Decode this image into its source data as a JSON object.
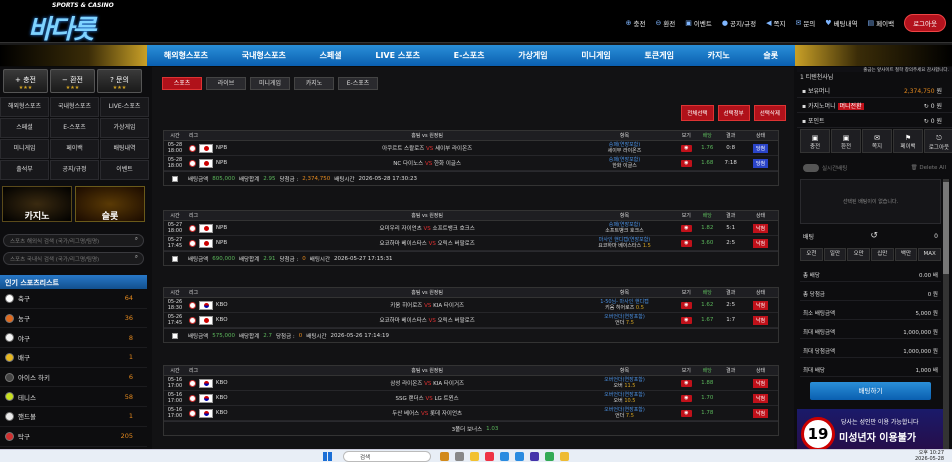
{
  "header": {
    "logo_sub": "SPORTS & CASINO",
    "logo_main": "바다릇",
    "nav": [
      {
        "icon": "plus-circle",
        "label": "충전"
      },
      {
        "icon": "minus-circle",
        "label": "환전"
      },
      {
        "icon": "gift",
        "label": "이벤트"
      },
      {
        "icon": "user",
        "label": "공지/규정"
      },
      {
        "icon": "megaphone",
        "label": "쪽지"
      },
      {
        "icon": "envelope",
        "label": "문의"
      },
      {
        "icon": "chat",
        "label": "베팅내역"
      },
      {
        "icon": "card",
        "label": "페이백"
      }
    ],
    "logout": "로그아웃"
  },
  "main_nav": [
    "해외형스포츠",
    "국내형스포츠",
    "스페셜",
    "LIVE 스포츠",
    "E-스포츠",
    "가상게임",
    "미니게임",
    "토큰게임",
    "카지노",
    "슬롯"
  ],
  "left": {
    "quick": [
      {
        "label": "충전",
        "icon": "+"
      },
      {
        "label": "환전",
        "icon": "−"
      },
      {
        "label": "문의",
        "icon": "?"
      }
    ],
    "grid": [
      "해외형스포츠",
      "국내형스포츠",
      "LIVE-스포츠",
      "스페셜",
      "E-스포츠",
      "가상게임",
      "미니게임",
      "페이백",
      "배팅내역",
      "출석부",
      "공지/규정",
      "이벤트"
    ],
    "casino": "카지노",
    "slot": "슬롯",
    "search1_ph": "스포츠 해외식 검색 (국가/리그명/팀명)",
    "search2_ph": "스포츠 국내식 검색 (국가/리그명/팀명)",
    "popular": "인기 스포츠리스트",
    "sports": [
      {
        "name": "축구",
        "count": "64",
        "color": "#ffffff"
      },
      {
        "name": "농구",
        "count": "36",
        "color": "#e06a1e"
      },
      {
        "name": "야구",
        "count": "8",
        "color": "#f4f4f4"
      },
      {
        "name": "배구",
        "count": "1",
        "color": "#e8b820"
      },
      {
        "name": "아이스 하키",
        "count": "6",
        "color": "#444"
      },
      {
        "name": "테니스",
        "count": "58",
        "color": "#c8e020"
      },
      {
        "name": "핸드볼",
        "count": "1",
        "color": "#eaeaea"
      },
      {
        "name": "탁구",
        "count": "205",
        "color": "#d03030"
      }
    ]
  },
  "center": {
    "tabs": [
      "스포츠",
      "라이브",
      "미니게임",
      "카지노",
      "E-스포츠"
    ],
    "actions": [
      "전체선택",
      "선택청부",
      "선택삭제"
    ],
    "headers": [
      "시간",
      "리그",
      "홈팀 vs 원정팀",
      "항목",
      "보기",
      "배당",
      "결과",
      "상태"
    ],
    "vs": "VS",
    "tables": [
      {
        "rows": [
          {
            "date": "05-28",
            "time": "18:00",
            "flag": "jp",
            "league": "NPB",
            "home": "아쿠르트 스왈로즈",
            "away": "세이부 라이온즈",
            "pick": "승패(연장포함)",
            "pick2": "세이부 라이온즈",
            "pick_odds": "",
            "odds": "1.76",
            "result": "0:8",
            "status": "당첨",
            "st": "win"
          },
          {
            "date": "05-28",
            "time": "18:00",
            "flag": "jp",
            "league": "NPB",
            "home": "NC 다이노스",
            "away": "한화 이글스",
            "pick": "승패(연장포함)",
            "pick2": "한화 이글스",
            "pick_odds": "",
            "odds": "1.68",
            "result": "7:18",
            "status": "당첨",
            "st": "win"
          }
        ],
        "sum": {
          "amount_label": "배팅금액",
          "amount": "805,000",
          "odds_label": "배당합계",
          "odds": "2.95",
          "win_label": "당첨금 :",
          "win": "2,374,750",
          "time_label": "배팅시간",
          "time": "2026-05-28 17:30:23"
        }
      },
      {
        "rows": [
          {
            "date": "05-27",
            "time": "18:00",
            "flag": "jp",
            "league": "NPB",
            "home": "요미우리 자이언츠",
            "away": "소프트뱅크 호크스",
            "pick": "승패(연장포함)",
            "pick2": "소프트뱅크 호크스",
            "pick_odds": "",
            "odds": "1.82",
            "result": "5:1",
            "status": "낙첨",
            "st": "lose"
          },
          {
            "date": "05-27",
            "time": "17:45",
            "flag": "jp",
            "league": "NPB",
            "home": "요코하마 베이스타스",
            "away": "오릭스 버팔로즈",
            "pick": "마사인 핸디캡(연장포함)",
            "pick2": "요코하마 베이스타스",
            "pick_odds": "1.5",
            "odds": "3.60",
            "result": "2:5",
            "status": "낙첨",
            "st": "lose"
          }
        ],
        "sum": {
          "amount_label": "배팅금액",
          "amount": "690,000",
          "odds_label": "배당합계",
          "odds": "2.91",
          "win_label": "당첨금 :",
          "win": "0",
          "time_label": "배팅시간",
          "time": "2026-05-27 17:15:31"
        }
      },
      {
        "rows": [
          {
            "date": "05-26",
            "time": "18:30",
            "flag": "kr",
            "league": "KBO",
            "home": "키움 히어로즈",
            "away": "KIA 타이거즈",
            "pick": "1-50님- 마사인 핸디캡",
            "pick2": "키움 히어로즈",
            "pick_odds": "0.5",
            "odds": "1.62",
            "result": "2:5",
            "status": "낙첨",
            "st": "lose"
          },
          {
            "date": "05-26",
            "time": "17:45",
            "flag": "jp",
            "league": "KBO",
            "home": "요코하마 베이스타스",
            "away": "오릭스 버팔로즈",
            "pick": "오버언더(연장포함)",
            "pick2": "언더",
            "pick_odds": "7.5",
            "odds": "1.67",
            "result": "1:7",
            "status": "낙첨",
            "st": "lose"
          }
        ],
        "sum": {
          "amount_label": "배팅금액",
          "amount": "575,000",
          "odds_label": "배당합계",
          "odds": "2.7",
          "win_label": "당첨금 :",
          "win": "0",
          "time_label": "배팅시간",
          "time": "2026-05-26 17:14:19"
        }
      },
      {
        "rows": [
          {
            "date": "05-16",
            "time": "17:00",
            "flag": "kr",
            "league": "KBO",
            "home": "삼성 라이온즈",
            "away": "KIA 타이거즈",
            "pick": "오버언더(연장포함)",
            "pick2": "오버",
            "pick_odds": "11.5",
            "odds": "1.88",
            "result": "",
            "status": "낙첨",
            "st": "lose"
          },
          {
            "date": "05-16",
            "time": "17:00",
            "flag": "kr",
            "league": "KBO",
            "home": "SSG 랜더스",
            "away": "LG 트윈스",
            "pick": "오버언더(연장포함)",
            "pick2": "오버",
            "pick_odds": "10.5",
            "odds": "1.70",
            "result": "",
            "status": "낙첨",
            "st": "lose"
          },
          {
            "date": "05-16",
            "time": "17:00",
            "flag": "kr",
            "league": "KBO",
            "home": "두산 베어스",
            "away": "롯데 자이언츠",
            "pick": "오버언더(연장포함)",
            "pick2": "언더",
            "pick_odds": "7.5",
            "odds": "1.78",
            "result": "",
            "status": "낙첨",
            "st": "lose"
          }
        ],
        "bonus": "3폴더 보너스",
        "bonus_val": "1.03"
      }
    ]
  },
  "right": {
    "notice": "출금는 앞사이트 철학 창의주세요 감사합니다.",
    "user": "1 티텐천사님",
    "money_label": "보유머니",
    "money": "2,374,750",
    "money_unit": "원",
    "casino_label": "카지노머니",
    "casino_badge": "머니전환",
    "casino": "0",
    "casino_unit": "원",
    "point_label": "포인트",
    "point": "0",
    "point_unit": "원",
    "buttons": [
      {
        "label": "충전",
        "icon": "▣"
      },
      {
        "label": "환전",
        "icon": "▣"
      },
      {
        "label": "쪽지",
        "icon": "✉"
      },
      {
        "label": "페이백",
        "icon": "⚑"
      },
      {
        "label": "로그아웃",
        "icon": "⎋"
      }
    ],
    "toggle_label": "실시간배팅",
    "delete_all": "Delete All",
    "empty": "선택된 배팅이이 없습니다.",
    "bet_label": "배팅",
    "bet_val": "0",
    "amounts": [
      "오천",
      "일만",
      "오만",
      "십만",
      "백만",
      "MAX"
    ],
    "lines": [
      {
        "l": "총 배당",
        "v": "0.00 배"
      },
      {
        "l": "총 당첨금",
        "v": "0 원"
      },
      {
        "l": "최소 배팅금액",
        "v": "5,000 원"
      },
      {
        "l": "최대 배팅금액",
        "v": "1,000,000 원"
      },
      {
        "l": "최대 당첨금액",
        "v": "1,000,000 원"
      },
      {
        "l": "최대 배당",
        "v": "1,000 배"
      }
    ],
    "betbtn": "배팅하기",
    "ad_small": "당사는 성인만 이용 가능합니다",
    "ad_big": "미성년자 이용불가",
    "ad_num": "19"
  },
  "taskbar": {
    "search": "검색",
    "time": "오후 10:27",
    "date": "2026-05-28"
  }
}
